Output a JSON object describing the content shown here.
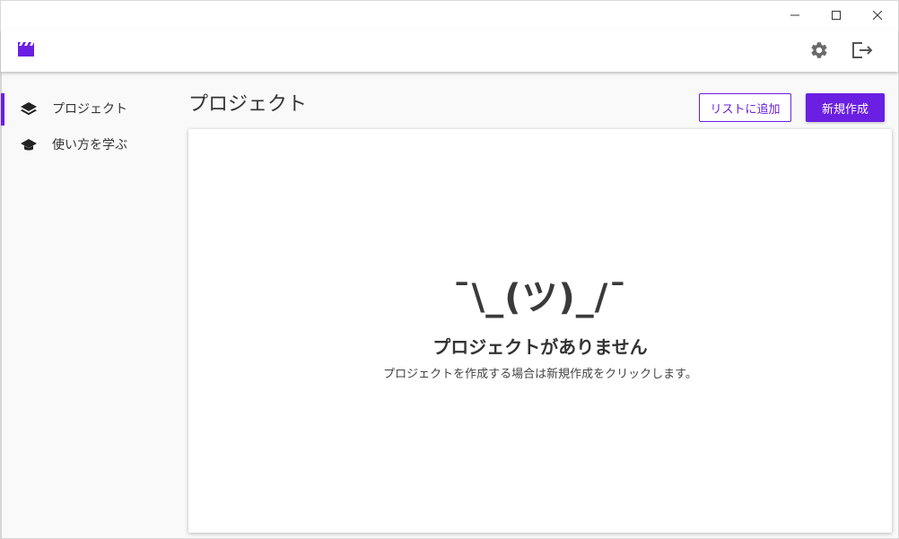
{
  "window": {
    "controls": {
      "minimize": "minimize-icon",
      "maximize": "maximize-icon",
      "close": "close-icon"
    }
  },
  "app": {
    "logo_icon": "clapperboard-icon",
    "accent": "#6a1fe3",
    "settings_icon": "gear-icon",
    "logout_icon": "logout-icon"
  },
  "sidebar": {
    "items": [
      {
        "label": "プロジェクト",
        "icon": "layers-icon",
        "active": true
      },
      {
        "label": "使い方を学ぶ",
        "icon": "graduation-cap-icon",
        "active": false
      }
    ]
  },
  "page": {
    "title": "プロジェクト",
    "add_to_list_label": "リストに追加",
    "new_label": "新規作成"
  },
  "empty_state": {
    "face": "¯\\_(ツ)_/¯",
    "title": "プロジェクトがありません",
    "description": "プロジェクトを作成する場合は新規作成をクリックします。"
  }
}
